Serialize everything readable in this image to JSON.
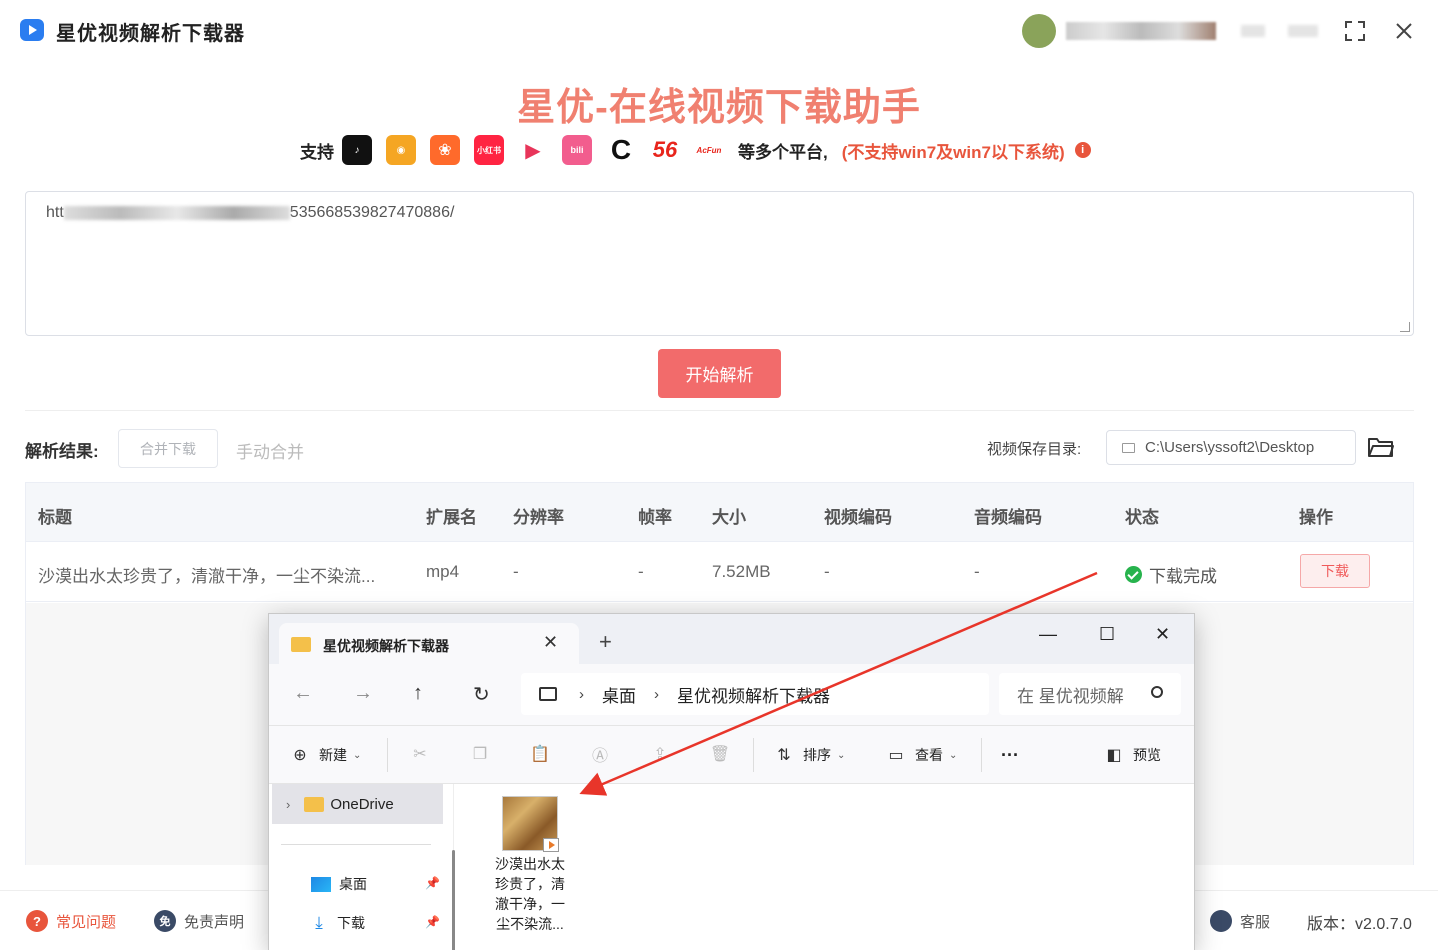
{
  "app": {
    "title": "星优视频解析下载器"
  },
  "hero": {
    "title": "星优-在线视频下载助手",
    "support_label": "支持",
    "platforms": [
      {
        "name": "douyin",
        "text": "♪",
        "color": "#111111"
      },
      {
        "name": "weibo",
        "text": "◉",
        "color": "#f5a623"
      },
      {
        "name": "kuaishou",
        "text": "❀",
        "color": "#ff6a2b"
      },
      {
        "name": "xiaohongshu",
        "text": "小红书",
        "color": "#ff2442"
      },
      {
        "name": "xigua",
        "text": "▶",
        "color": "#ffffff"
      },
      {
        "name": "bilibili",
        "text": "bili",
        "color": "#f25d8e"
      },
      {
        "name": "cntv",
        "text": "C",
        "color": "#ffffff"
      },
      {
        "name": "56",
        "text": "56",
        "color": "#ffffff"
      },
      {
        "name": "acfun",
        "text": "AcFun",
        "color": "#ffffff"
      }
    ],
    "more_text": "等多个平台,",
    "warning": "(不支持win7及win7以下系统)",
    "info_glyph": "i"
  },
  "url_input": {
    "prefix": "htt",
    "suffix": "535668539827470886/"
  },
  "parse_button": "开始解析",
  "results": {
    "label": "解析结果:",
    "merge_download": "合并下载",
    "manual_merge": "手动合并",
    "save_dir_label": "视频保存目录:",
    "save_dir_value": "C:\\Users\\yssoft2\\Desktop"
  },
  "table": {
    "headers": {
      "title": "标题",
      "ext": "扩展名",
      "resolution": "分辨率",
      "fps": "帧率",
      "size": "大小",
      "vcodec": "视频编码",
      "acodec": "音频编码",
      "status": "状态",
      "action": "操作"
    },
    "rows": [
      {
        "title": "沙漠出水太珍贵了，清澈干净，一尘不染流...",
        "ext": "mp4",
        "resolution": "-",
        "fps": "-",
        "size": "7.52MB",
        "vcodec": "-",
        "acodec": "-",
        "status": "下载完成",
        "action": "下载"
      }
    ]
  },
  "footer": {
    "faq": "常见问题",
    "faq_glyph": "?",
    "disclaimer": "免责声明",
    "disclaimer_glyph": "免",
    "service": "客服",
    "version": "版本：v2.0.7.0"
  },
  "explorer": {
    "tab_title": "星优视频解析下载器",
    "breadcrumb": [
      "桌面",
      "星优视频解析下载器"
    ],
    "search_placeholder": "在 星优视频解",
    "toolbar": {
      "new": "新建",
      "sort": "排序",
      "view": "查看",
      "more": "···",
      "preview": "预览"
    },
    "sidebar": {
      "onedrive": "OneDrive",
      "desktop": "桌面",
      "downloads": "下载"
    },
    "file_name": "沙漠出水太珍贵了，清澈干净，一尘不染流..."
  },
  "colors": {
    "accent": "#f26b6b",
    "hero_title": "#f08070",
    "warning": "#e8553c",
    "success": "#27b34d",
    "annotation_arrow": "#e8352a"
  }
}
